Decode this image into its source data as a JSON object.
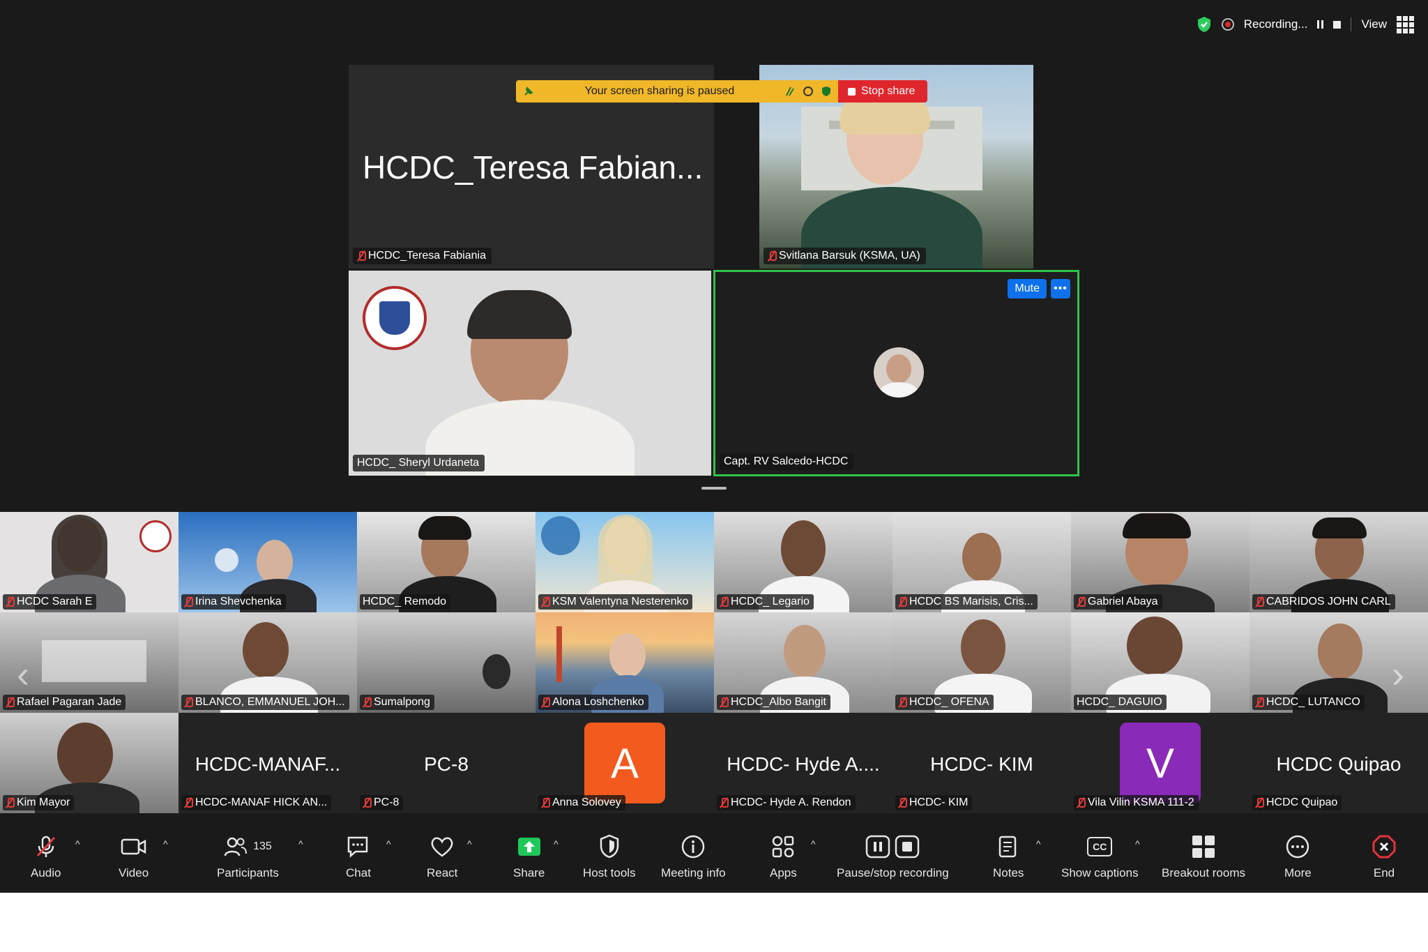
{
  "topbar": {
    "recording_label": "Recording...",
    "view_label": "View"
  },
  "share_banner": {
    "message": "Your screen sharing is paused",
    "stop_label": "Stop share"
  },
  "stage": {
    "tile1_big_name": "HCDC_Teresa Fabian...",
    "tile1_name": "HCDC_Teresa Fabiania",
    "tile2_name": "Svitlana Barsuk (KSMA, UA)",
    "tile3_name": "HCDC_ Sheryl Urdaneta",
    "tile4_name": "Capt. RV Salcedo-HCDC",
    "mute_label": "Mute",
    "more_label": "•••"
  },
  "gallery": {
    "row1": [
      "HCDC Sarah E",
      "Irina Shevchenka",
      "HCDC_ Remodo",
      "KSM Valentyna Nesterenko",
      "HCDC_ Legario",
      "HCDC BS Marisis, Cris...",
      "Gabriel Abaya",
      "CABRIDOS JOHN CARL"
    ],
    "row2": [
      "Rafael Pagaran Jade",
      "BLANCO, EMMANUEL JOH...",
      "Sumalpong",
      "Alona Loshchenko",
      "HCDC_Albo Bangit",
      "HCDC_ OFENA",
      "HCDC_ DAGUIO",
      "HCDC_ LUTANCO"
    ],
    "row3_big": [
      "",
      "HCDC-MANAF...",
      "PC-8",
      "A",
      "HCDC- Hyde A....",
      "HCDC- KIM",
      "V",
      "HCDC Quipao"
    ],
    "row3_names": [
      "Kim Mayor",
      "HCDC-MANAF HICK AN...",
      "PC-8",
      "Anna Solovey",
      "HCDC- Hyde A. Rendon",
      "HCDC- KIM",
      "Vila Vilin KSMA 111-2",
      "HCDC Quipao"
    ]
  },
  "toolbar": {
    "audio": "Audio",
    "video": "Video",
    "participants": "Participants",
    "participants_count": "135",
    "chat": "Chat",
    "react": "React",
    "share": "Share",
    "host_tools": "Host tools",
    "meeting_info": "Meeting info",
    "apps": "Apps",
    "pause_stop_recording": "Pause/stop recording",
    "notes": "Notes",
    "show_captions": "Show captions",
    "cc_label": "CC",
    "breakout_rooms": "Breakout rooms",
    "more": "More",
    "end": "End"
  },
  "colors": {
    "share_banner": "#f0b729",
    "stop_share": "#e0262d",
    "mute_button": "#0e71eb",
    "active_speaker_border": "#30c34a",
    "share_icon": "#1fc85a",
    "avatar_a": "#f25a1e",
    "avatar_v": "#8a2ab8",
    "end_icon": "#e5323c"
  }
}
